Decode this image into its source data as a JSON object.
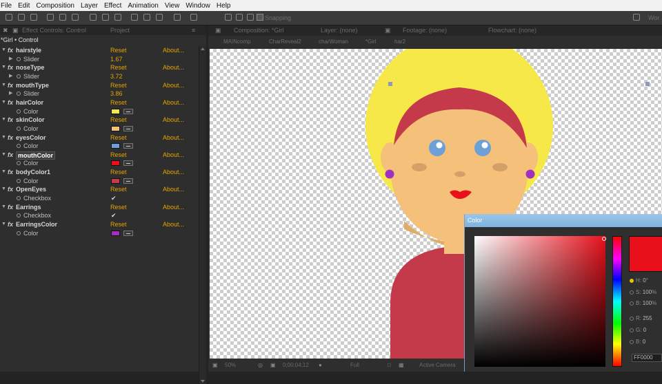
{
  "menu": [
    "File",
    "Edit",
    "Composition",
    "Layer",
    "Effect",
    "Animation",
    "View",
    "Window",
    "Help"
  ],
  "toolbar": {
    "snapping": "Snapping",
    "workspace": "Wor"
  },
  "effect_controls": {
    "tab_title": "Effect Controls: Control",
    "tab_project": "Project",
    "layer_line": "*Girl • Control",
    "reset_label": "Reset",
    "about_label": "About...",
    "effects": [
      {
        "name": "hairstyle",
        "prop": "Slider",
        "type": "slider",
        "value": "1.67"
      },
      {
        "name": "noseType",
        "prop": "Slider",
        "type": "slider",
        "value": "3.72"
      },
      {
        "name": "mouthType",
        "prop": "Slider",
        "type": "slider",
        "value": "3.86"
      },
      {
        "name": "hairColor",
        "prop": "Color",
        "type": "color",
        "color": "#f7e84a"
      },
      {
        "name": "skinColor",
        "prop": "Color",
        "type": "color",
        "color": "#f5c07a"
      },
      {
        "name": "eyesColor",
        "prop": "Color",
        "type": "color",
        "color": "#6ea0d8"
      },
      {
        "name": "mouthColor",
        "prop": "Color",
        "type": "color",
        "color": "#e8101a",
        "selected": true
      },
      {
        "name": "bodyColor1",
        "prop": "Color",
        "type": "color",
        "color": "#c43a4a"
      },
      {
        "name": "OpenEyes",
        "prop": "Checkbox",
        "type": "checkbox",
        "checked": true
      },
      {
        "name": "Earrings",
        "prop": "Checkbox",
        "type": "checkbox",
        "checked": true
      },
      {
        "name": "EarringsColor",
        "prop": "Color",
        "type": "color",
        "color": "#a030c0"
      }
    ]
  },
  "composition": {
    "tabs": [
      "Composition: *Girl",
      "Layer: (none)",
      "Footage: (none)",
      "Flowchart: (none)"
    ],
    "breadcrumbs": [
      "MAINcomp",
      "CharReveal2",
      "charWoman",
      "*Girl",
      "har2"
    ],
    "bottom": {
      "zoom": "50%",
      "timecode": "0;00;04;12",
      "resolution": "Full",
      "camera": "Active Camera"
    }
  },
  "colors": {
    "hair": "#f7e84a",
    "skin": "#f5c07a",
    "band": "#c43a4a",
    "eye": "#6ea0d8",
    "cheek": "#d4a06a",
    "lips": "#e8101a",
    "earring": "#a030c0",
    "body": "#c43a4a",
    "chin": "#e0ac66"
  },
  "color_dialog": {
    "title": "Color",
    "hue_color": "#e8101a",
    "swatch_color": "#e8101a",
    "fields": [
      {
        "label": "H:",
        "value": "0",
        "unit": "°",
        "selected": true
      },
      {
        "label": "S:",
        "value": "100",
        "unit": "%",
        "selected": false
      },
      {
        "label": "B:",
        "value": "100",
        "unit": "%",
        "selected": false
      },
      {
        "label": "R:",
        "value": "255",
        "unit": "",
        "selected": false
      },
      {
        "label": "G:",
        "value": "0",
        "unit": "",
        "selected": false
      },
      {
        "label": "B:",
        "value": "0",
        "unit": "",
        "selected": false
      }
    ],
    "hex": "FF0000"
  }
}
